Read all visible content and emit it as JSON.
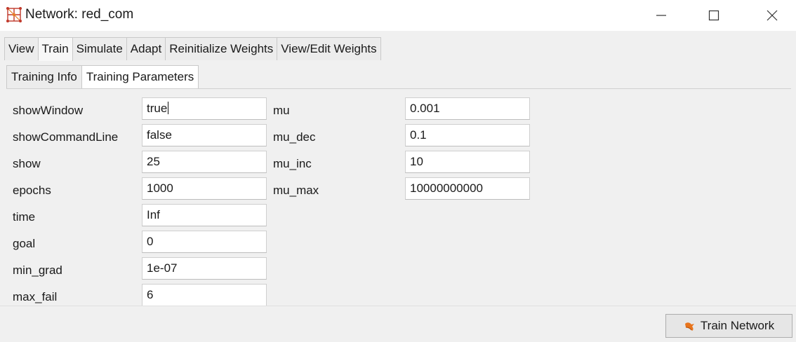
{
  "window": {
    "title": "Network: red_com"
  },
  "main_tabs": [
    {
      "label": "View",
      "active": false
    },
    {
      "label": "Train",
      "active": true
    },
    {
      "label": "Simulate",
      "active": false
    },
    {
      "label": "Adapt",
      "active": false
    },
    {
      "label": "Reinitialize Weights",
      "active": false
    },
    {
      "label": "View/Edit Weights",
      "active": false
    }
  ],
  "sub_tabs": [
    {
      "label": "Training Info",
      "active": false
    },
    {
      "label": "Training Parameters",
      "active": true
    }
  ],
  "params_left": [
    {
      "label": "showWindow",
      "value": "true"
    },
    {
      "label": "showCommandLine",
      "value": "false"
    },
    {
      "label": "show",
      "value": "25"
    },
    {
      "label": "epochs",
      "value": "1000"
    },
    {
      "label": "time",
      "value": "Inf"
    },
    {
      "label": "goal",
      "value": "0"
    },
    {
      "label": "min_grad",
      "value": "1e-07"
    },
    {
      "label": "max_fail",
      "value": "6"
    }
  ],
  "params_right": [
    {
      "label": "mu",
      "value": "0.001"
    },
    {
      "label": "mu_dec",
      "value": "0.1"
    },
    {
      "label": "mu_inc",
      "value": "10"
    },
    {
      "label": "mu_max",
      "value": "10000000000"
    }
  ],
  "actions": {
    "train_label": "Train Network",
    "train_icon": "train-network-icon"
  },
  "colors": {
    "window_bg": "#f0f0f0",
    "field_bg": "#ffffff",
    "icon_orange": "#e8741c"
  }
}
